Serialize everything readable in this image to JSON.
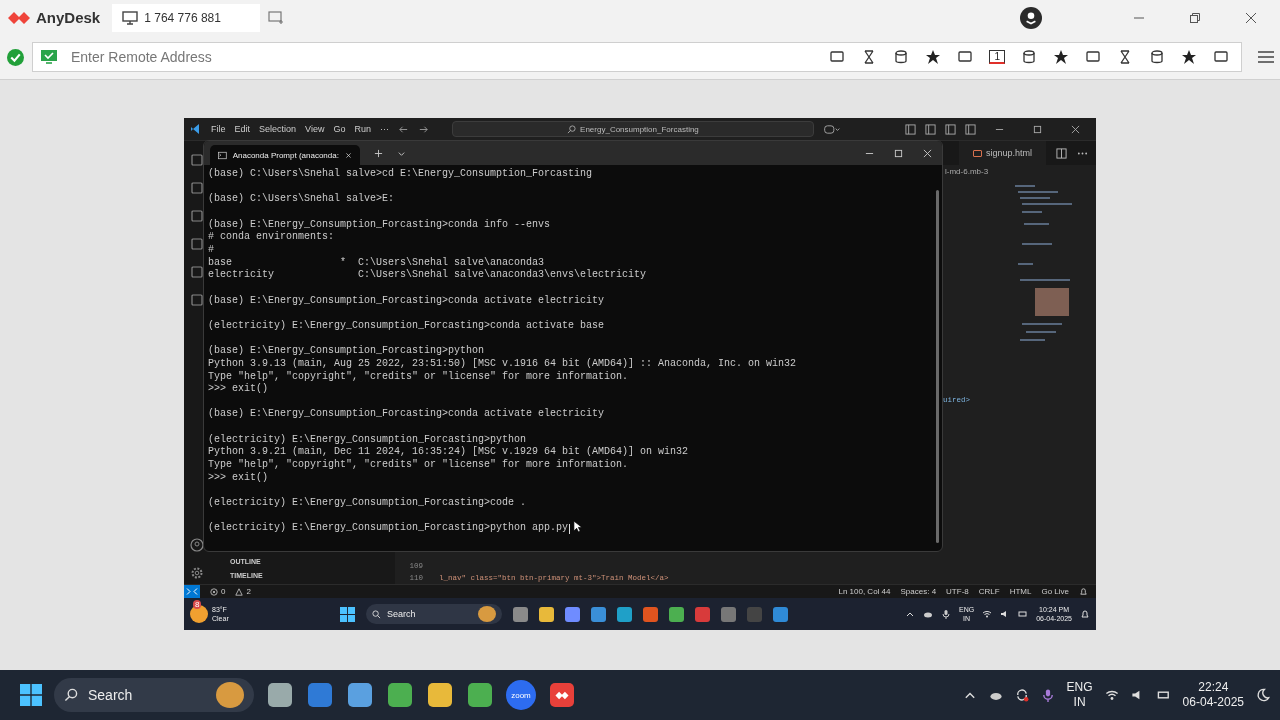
{
  "anydesk": {
    "app_name": "AnyDesk",
    "session_id": "1 764 776 881",
    "address_placeholder": "Enter Remote Address",
    "monitor_number": "1"
  },
  "vscode": {
    "menu": [
      "File",
      "Edit",
      "Selection",
      "View",
      "Go",
      "Run"
    ],
    "menu_more": "···",
    "search": "Energy_Consumption_Forcasting",
    "tab": "signup.html",
    "breadcrumb": "l-md-6.mb-3",
    "code_fragment": "uired>",
    "panels": [
      "OUTLINE",
      "TIMELINE"
    ],
    "code_lines": [
      {
        "number": "109"
      },
      {
        "number": "110",
        "text": "l_nav\" class=\"btn btn-primary mt-3\">Train Model</a>"
      }
    ],
    "status": {
      "errors": "0",
      "warnings": "2",
      "items": [
        "Ln 100, Col 44",
        "Spaces: 4",
        "UTF-8",
        "CRLF",
        "HTML",
        "Go Live"
      ]
    }
  },
  "terminal": {
    "title": "Anaconda Prompt (anaconda:",
    "blocks": [
      [
        "(base) C:\\Users\\Snehal salve>cd E:\\Energy_Consumption_Forcasting"
      ],
      [
        "(base) C:\\Users\\Snehal salve>E:"
      ],
      [
        "(base) E:\\Energy_Consumption_Forcasting>conda info --envs",
        "# conda environments:",
        "#",
        "base                  *  C:\\Users\\Snehal salve\\anaconda3",
        "electricity              C:\\Users\\Snehal salve\\anaconda3\\envs\\electricity"
      ],
      [
        "(base) E:\\Energy_Consumption_Forcasting>conda activate electricity"
      ],
      [
        "(electricity) E:\\Energy_Consumption_Forcasting>conda activate base"
      ],
      [
        "(base) E:\\Energy_Consumption_Forcasting>python",
        "Python 3.9.13 (main, Aug 25 2022, 23:51:50) [MSC v.1916 64 bit (AMD64)] :: Anaconda, Inc. on win32",
        "Type \"help\", \"copyright\", \"credits\" or \"license\" for more information.",
        ">>> exit()"
      ],
      [
        "(base) E:\\Energy_Consumption_Forcasting>conda activate electricity"
      ],
      [
        "(electricity) E:\\Energy_Consumption_Forcasting>python",
        "Python 3.9.21 (main, Dec 11 2024, 16:35:24) [MSC v.1929 64 bit (AMD64)] on win32",
        "Type \"help\", \"copyright\", \"credits\" or \"license\" for more information.",
        ">>> exit()"
      ],
      [
        "(electricity) E:\\Energy_Consumption_Forcasting>code ."
      ],
      [
        "(electricity) E:\\Energy_Consumption_Forcasting>python app.py"
      ]
    ]
  },
  "remote_taskbar": {
    "weather_badge": "8",
    "temperature": "83°F",
    "condition": "Clear",
    "search": "Search",
    "language": "ENG",
    "region": "IN",
    "time": "10:24 PM",
    "date": "06-04-2025"
  },
  "local_taskbar": {
    "search": "Search",
    "zoom_label": "zoom",
    "language": "ENG",
    "region": "IN",
    "time": "22:24",
    "date": "06-04-2025"
  }
}
